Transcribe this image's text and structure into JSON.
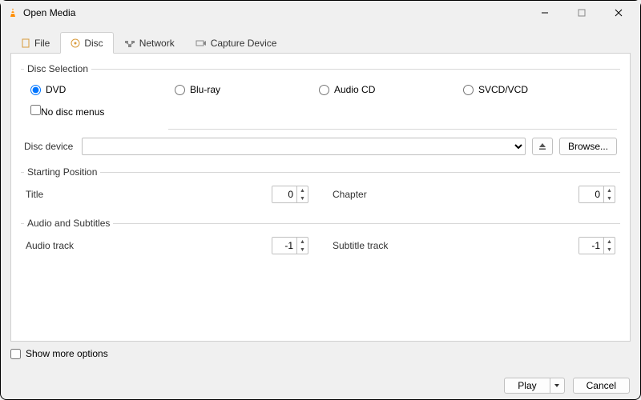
{
  "window": {
    "title": "Open Media"
  },
  "tabs": {
    "file": "File",
    "disc": "Disc",
    "network": "Network",
    "capture": "Capture Device"
  },
  "disc": {
    "selection_legend": "Disc Selection",
    "types": {
      "dvd": "DVD",
      "bluray": "Blu-ray",
      "audiocd": "Audio CD",
      "svcd": "SVCD/VCD"
    },
    "no_menus": "No disc menus",
    "device_label": "Disc device",
    "browse": "Browse..."
  },
  "start": {
    "legend": "Starting Position",
    "title_label": "Title",
    "title_value": "0",
    "chapter_label": "Chapter",
    "chapter_value": "0"
  },
  "audio": {
    "legend": "Audio and Subtitles",
    "audio_track_label": "Audio track",
    "audio_track_value": "-1",
    "subtitle_track_label": "Subtitle track",
    "subtitle_track_value": "-1"
  },
  "more_options": "Show more options",
  "actions": {
    "play": "Play",
    "cancel": "Cancel"
  }
}
